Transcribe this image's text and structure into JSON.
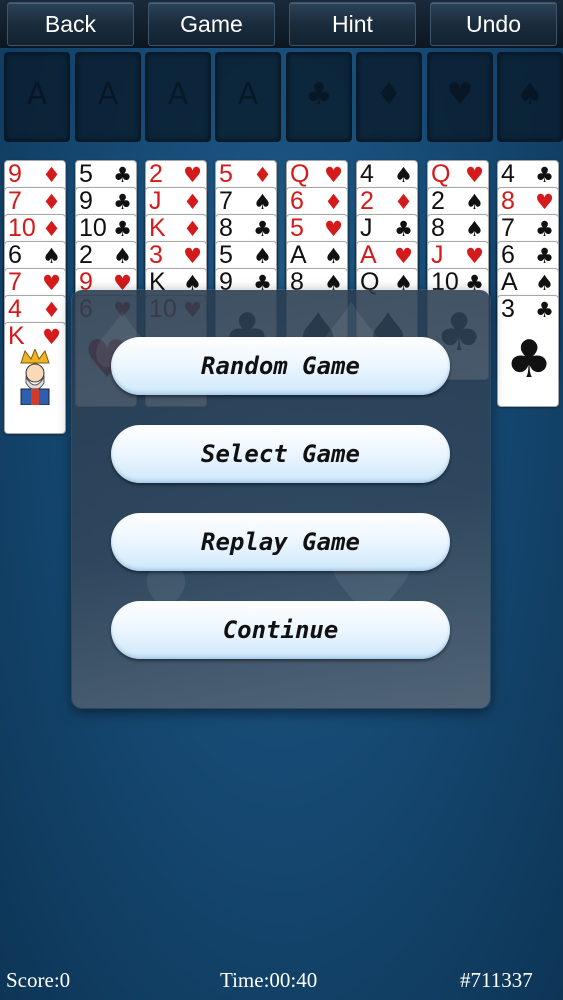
{
  "toolbar": {
    "back_label": "Back",
    "game_label": "Game",
    "hint_label": "Hint",
    "undo_label": "Undo"
  },
  "foundation_slots": [
    "A",
    "A",
    "A",
    "A",
    "♣",
    "♦",
    "♥",
    "♠"
  ],
  "tableau": [
    {
      "cards": [
        [
          "9",
          "♦",
          "red"
        ],
        [
          "7",
          "♦",
          "red"
        ],
        [
          "10",
          "♦",
          "red"
        ],
        [
          "6",
          "♠",
          "blk"
        ],
        [
          "7",
          "♥",
          "red"
        ],
        [
          "4",
          "♦",
          "red"
        ],
        [
          "K",
          "♥",
          "red"
        ]
      ]
    },
    {
      "cards": [
        [
          "5",
          "♣",
          "blk"
        ],
        [
          "9",
          "♣",
          "blk"
        ],
        [
          "10",
          "♣",
          "blk"
        ],
        [
          "2",
          "♠",
          "blk"
        ],
        [
          "9",
          "♥",
          "red"
        ],
        [
          "6",
          "♥",
          "red"
        ]
      ]
    },
    {
      "cards": [
        [
          "2",
          "♥",
          "red"
        ],
        [
          "J",
          "♦",
          "red"
        ],
        [
          "K",
          "♦",
          "red"
        ],
        [
          "3",
          "♥",
          "red"
        ],
        [
          "K",
          "♠",
          "blk"
        ],
        [
          "10",
          "♥",
          "red"
        ]
      ]
    },
    {
      "cards": [
        [
          "5",
          "♦",
          "red"
        ],
        [
          "7",
          "♠",
          "blk"
        ],
        [
          "8",
          "♣",
          "blk"
        ],
        [
          "5",
          "♠",
          "blk"
        ],
        [
          "9",
          "♣",
          "blk"
        ]
      ]
    },
    {
      "cards": [
        [
          "Q",
          "♥",
          "red"
        ],
        [
          "6",
          "♦",
          "red"
        ],
        [
          "5",
          "♥",
          "red"
        ],
        [
          "A",
          "♠",
          "blk"
        ],
        [
          "8",
          "♠",
          "blk"
        ]
      ]
    },
    {
      "cards": [
        [
          "4",
          "♠",
          "blk"
        ],
        [
          "2",
          "♦",
          "red"
        ],
        [
          "J",
          "♣",
          "blk"
        ],
        [
          "A",
          "♥",
          "red"
        ],
        [
          "Q",
          "♠",
          "blk"
        ]
      ]
    },
    {
      "cards": [
        [
          "Q",
          "♥",
          "red"
        ],
        [
          "2",
          "♠",
          "blk"
        ],
        [
          "8",
          "♠",
          "blk"
        ],
        [
          "J",
          "♥",
          "red"
        ],
        [
          "10",
          "♣",
          "blk"
        ]
      ]
    },
    {
      "cards": [
        [
          "4",
          "♣",
          "blk"
        ],
        [
          "8",
          "♥",
          "red"
        ],
        [
          "7",
          "♣",
          "blk"
        ],
        [
          "6",
          "♣",
          "blk"
        ],
        [
          "A",
          "♠",
          "blk"
        ],
        [
          "3",
          "♣",
          "blk"
        ]
      ]
    }
  ],
  "menu": {
    "random_game": "Random Game",
    "select_game": "Select Game",
    "replay_game": "Replay Game",
    "continue": "Continue"
  },
  "status": {
    "score": "Score:0",
    "time": "Time:00:40",
    "game_number": "#711337"
  },
  "colors": {
    "felt": "#164a74",
    "red_suit": "#d41a1a",
    "button_face": "#eef7ff"
  }
}
